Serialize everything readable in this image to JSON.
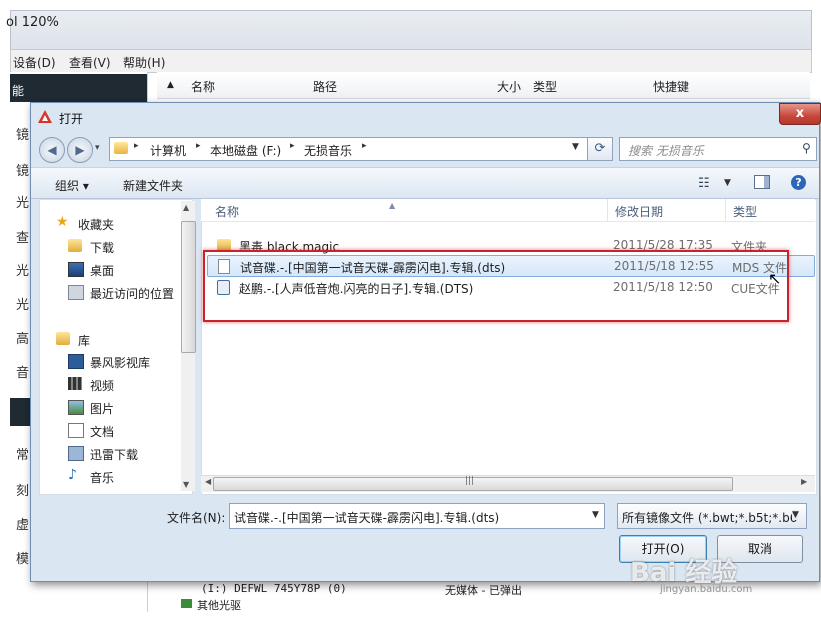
{
  "background_app": {
    "title": "ol 120%",
    "menu": [
      "设备(D)",
      "查看(V)",
      "帮助(H)"
    ],
    "side_chars": [
      "镜",
      "镜",
      "光",
      "查",
      "光",
      "光",
      "高",
      "音",
      "常",
      "刻",
      "虚",
      "模"
    ],
    "columns": [
      "名称",
      "路径",
      "大小",
      "类型",
      "快捷键"
    ],
    "bottom_rows": [
      "(I:) DEFWL 745Y78P (0)",
      "无媒体 - 已弹出",
      "其他光驱"
    ],
    "sidebar_title_glyph": "能"
  },
  "dialog": {
    "title": "打开",
    "close_label": "x",
    "breadcrumb": [
      "计算机",
      "本地磁盘 (F:)",
      "无损音乐"
    ],
    "search": {
      "placeholder": "搜索 无损音乐"
    },
    "toolbar": {
      "organize": "组织 ▾",
      "new_folder": "新建文件夹"
    },
    "nav_pane": {
      "favorites_header": "收藏夹",
      "favorites": [
        "下载",
        "桌面",
        "最近访问的位置"
      ],
      "libraries_header": "库",
      "libraries": [
        "暴风影视库",
        "视频",
        "图片",
        "文档",
        "迅雷下载",
        "音乐"
      ]
    },
    "file_columns": [
      "名称",
      "修改日期",
      "类型"
    ],
    "files": [
      {
        "name": "黑毒 black.magic",
        "date": "2011/5/28 17:35",
        "type": "文件夹",
        "icon": "folder-icon",
        "selected": false
      },
      {
        "name": "试音碟.-.[中国第一试音天碟-霹雳闪电].专辑.(dts)",
        "date": "2011/5/18 12:55",
        "type": "MDS 文件",
        "icon": "file-icon",
        "selected": true
      },
      {
        "name": "赵鹏.-.[人声低音炮.闪亮的日子].专辑.(DTS)",
        "date": "2011/5/18 12:50",
        "type": "CUE文件",
        "icon": "cue-file-icon",
        "selected": false
      }
    ],
    "filename_label": "文件名(N):",
    "filename_value": "试音碟.-.[中国第一试音天碟-霹雳闪电].专辑.(dts)",
    "filter_value": "所有镜像文件 (*.bwt;*.b5t;*.b6",
    "open_button": "打开(O)",
    "cancel_button": "取消"
  },
  "watermark": {
    "text": "Bai 经验",
    "sub": "jingyan.baidu.com"
  },
  "colors": {
    "highlight": "#c8232c",
    "selection": "#d5e7fa",
    "dialog_frame": "#dbe6f3"
  }
}
